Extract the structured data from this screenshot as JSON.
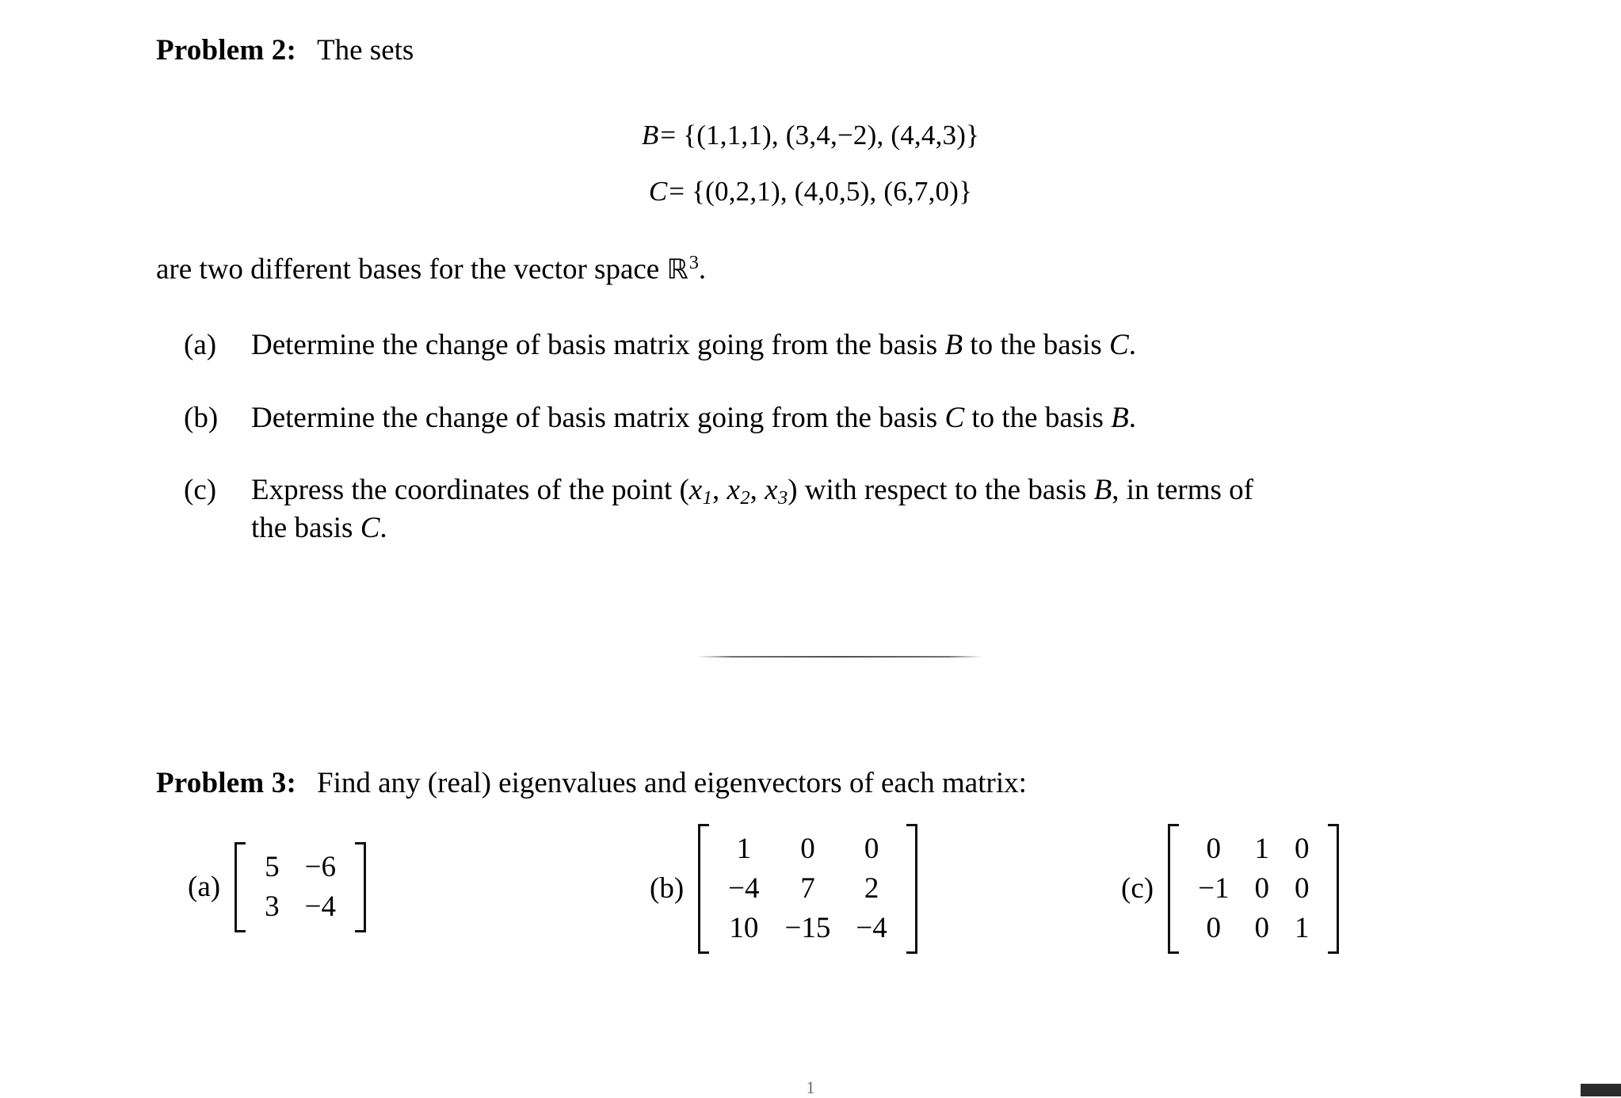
{
  "document": {
    "problem2": {
      "label": "Problem 2:",
      "intro": "The sets",
      "equations": [
        {
          "name": "B",
          "body": "= {(1,1,1), (3,4,−2), (4,4,3)}"
        },
        {
          "name": "C",
          "body": "= {(0,2,1), (4,0,5), (6,7,0)}"
        }
      ],
      "after_equations_line": {
        "pre": "are two different bases for the vector space ",
        "symbol": "ℝ",
        "exponent": "3",
        "post": "."
      },
      "items": [
        {
          "marker": "(a)",
          "parts": [
            {
              "t": "Determine the change of basis matrix going from the basis "
            },
            {
              "t": "B",
              "style": "italic"
            },
            {
              "t": " to the basis "
            },
            {
              "t": "C",
              "style": "italic"
            },
            {
              "t": "."
            }
          ]
        },
        {
          "marker": "(b)",
          "parts": [
            {
              "t": "Determine the change of basis matrix going from the basis "
            },
            {
              "t": "C",
              "style": "italic"
            },
            {
              "t": " to the basis "
            },
            {
              "t": "B",
              "style": "italic"
            },
            {
              "t": "."
            }
          ]
        },
        {
          "marker": "(c)",
          "parts": [
            {
              "t": "Express the coordinates of the point ("
            },
            {
              "t": "x",
              "style": "italic"
            },
            {
              "t": "1",
              "style": "sub"
            },
            {
              "t": ", "
            },
            {
              "t": "x",
              "style": "italic"
            },
            {
              "t": "2",
              "style": "sub"
            },
            {
              "t": ", "
            },
            {
              "t": "x",
              "style": "italic"
            },
            {
              "t": "3",
              "style": "sub"
            },
            {
              "t": ") with respect to the basis "
            },
            {
              "t": "B",
              "style": "italic"
            },
            {
              "t": ", in terms of"
            },
            {
              "t": "\n"
            },
            {
              "t": "the basis "
            },
            {
              "t": "C",
              "style": "italic"
            },
            {
              "t": "."
            }
          ]
        }
      ]
    },
    "problem3": {
      "label": "Problem 3:",
      "intro": "Find any (real) eigenvalues and eigenvectors of each matrix:",
      "matrices": [
        {
          "marker": "(a)",
          "rows": [
            [
              "5",
              "−6"
            ],
            [
              "3",
              "−4"
            ]
          ]
        },
        {
          "marker": "(b)",
          "rows": [
            [
              "1",
              "0",
              "0"
            ],
            [
              "−4",
              "7",
              "2"
            ],
            [
              "10",
              "−15",
              "−4"
            ]
          ]
        },
        {
          "marker": "(c)",
          "rows": [
            [
              "0",
              "1",
              "0"
            ],
            [
              "−1",
              "0",
              "0"
            ],
            [
              "0",
              "0",
              "1"
            ]
          ]
        }
      ]
    },
    "footer": {
      "page_marker": "1"
    }
  }
}
